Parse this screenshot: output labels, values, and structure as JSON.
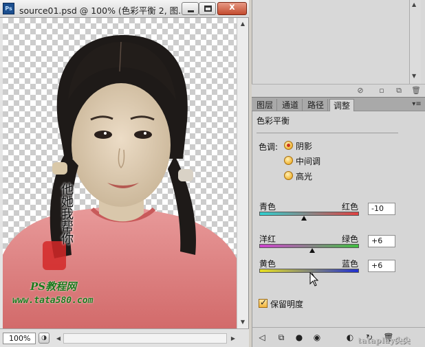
{
  "document": {
    "app_icon_text": "Ps",
    "title": "source01.psd @ 100% (色彩平衡 2, 图...",
    "close_glyph": "x",
    "zoom_value": "100%"
  },
  "panels": {
    "tabs": [
      "图层",
      "通道",
      "路径",
      "调整"
    ],
    "active_tab": "调整"
  },
  "adjustments": {
    "title": "色彩平衡",
    "tone_label": "色调:",
    "tones": [
      {
        "label": "阴影",
        "checked": true
      },
      {
        "label": "中间调",
        "checked": false
      },
      {
        "label": "高光",
        "checked": false
      }
    ],
    "sliders": [
      {
        "left": "青色",
        "right": "红色",
        "value": "-10",
        "level": -10,
        "range": [
          -100,
          100
        ],
        "colors": [
          "#30d0d0",
          "#e04040"
        ]
      },
      {
        "left": "洋红",
        "right": "绿色",
        "value": "+6",
        "level": 6,
        "range": [
          -100,
          100
        ],
        "colors": [
          "#d040d0",
          "#40c040"
        ]
      },
      {
        "left": "黄色",
        "right": "蓝色",
        "value": "+6",
        "level": 6,
        "range": [
          -100,
          100
        ],
        "colors": [
          "#e8e020",
          "#2030d0"
        ]
      }
    ],
    "preserve_label": "保留明度",
    "preserve_checked": true
  },
  "overlay": {
    "calligraphy": "他她我帮你",
    "site_name": "PS教程网",
    "site_url": "www.tata580.com",
    "watermark": "tataplay尖尖"
  },
  "colors": {
    "accent_radio": "#f0b636",
    "ps_blue": "#1c4f8f"
  }
}
